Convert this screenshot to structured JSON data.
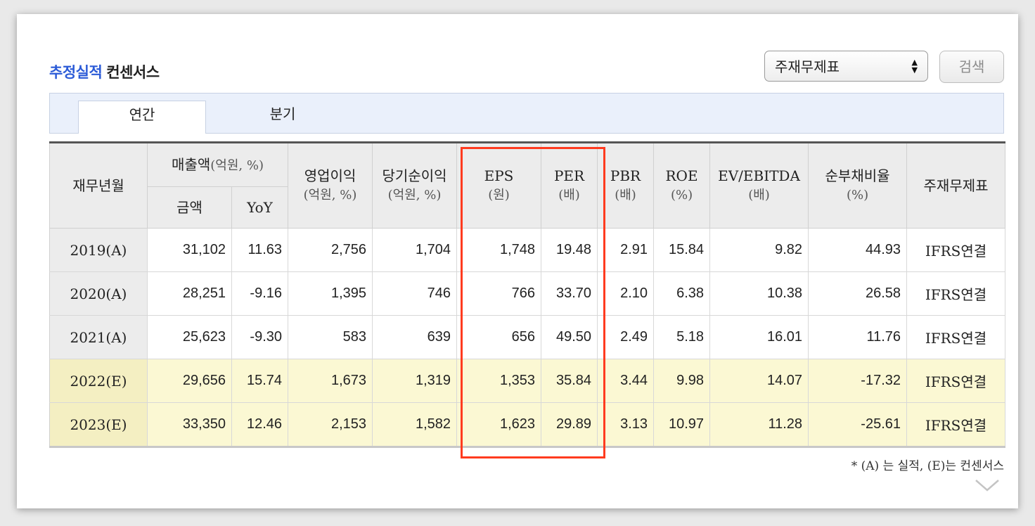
{
  "header": {
    "title_accent": "추정실적",
    "title_rest": "컨센서스",
    "select_value": "주재무제표",
    "search_label": "검색"
  },
  "tabs": [
    {
      "label": "연간",
      "active": true
    },
    {
      "label": "분기",
      "active": false
    }
  ],
  "table": {
    "headers": {
      "period": "재무년월",
      "revenue": "매출액",
      "revenue_unit": "(억원, %)",
      "revenue_amount": "금액",
      "revenue_yoy": "YoY",
      "op_income": "영업이익",
      "op_income_unit": "(억원, %)",
      "net_income": "당기순이익",
      "net_income_unit": "(억원, %)",
      "eps": "EPS",
      "eps_unit": "(원)",
      "per": "PER",
      "per_unit": "(배)",
      "pbr": "PBR",
      "pbr_unit": "(배)",
      "roe": "ROE",
      "roe_unit": "(%)",
      "ev_ebitda": "EV/EBITDA",
      "ev_ebitda_unit": "(배)",
      "net_debt_ratio": "순부채비율",
      "net_debt_ratio_unit": "(%)",
      "statement": "주재무제표"
    },
    "rows": [
      {
        "period": "2019(A)",
        "revenue": "31,102",
        "yoy": "11.63",
        "op": "2,756",
        "net": "1,704",
        "eps": "1,748",
        "per": "19.48",
        "pbr": "2.91",
        "roe": "15.84",
        "ev": "9.82",
        "debt": "44.93",
        "std": "IFRS연결"
      },
      {
        "period": "2020(A)",
        "revenue": "28,251",
        "yoy": "-9.16",
        "op": "1,395",
        "net": "746",
        "eps": "766",
        "per": "33.70",
        "pbr": "2.10",
        "roe": "6.38",
        "ev": "10.38",
        "debt": "26.58",
        "std": "IFRS연결"
      },
      {
        "period": "2021(A)",
        "revenue": "25,623",
        "yoy": "-9.30",
        "op": "583",
        "net": "639",
        "eps": "656",
        "per": "49.50",
        "pbr": "2.49",
        "roe": "5.18",
        "ev": "16.01",
        "debt": "11.76",
        "std": "IFRS연결"
      },
      {
        "period": "2022(E)",
        "revenue": "29,656",
        "yoy": "15.74",
        "op": "1,673",
        "net": "1,319",
        "eps": "1,353",
        "per": "35.84",
        "pbr": "3.44",
        "roe": "9.98",
        "ev": "14.07",
        "debt": "-17.32",
        "std": "IFRS연결"
      },
      {
        "period": "2023(E)",
        "revenue": "33,350",
        "yoy": "12.46",
        "op": "2,153",
        "net": "1,582",
        "eps": "1,623",
        "per": "29.89",
        "pbr": "3.13",
        "roe": "10.97",
        "ev": "11.28",
        "debt": "-25.61",
        "std": "IFRS연결"
      }
    ]
  },
  "footnote": "* (A) 는 실적, (E)는 컨센서스",
  "colors": {
    "accent": "#2b5bd7",
    "negative": "#e00000",
    "highlight_box": "#ff3b1f",
    "estimate_row": "#fbf8d3",
    "tab_bar": "#eaf0fb"
  },
  "icons": {
    "select_arrows": "updown-arrows-icon",
    "expand": "chevron-down-icon"
  }
}
